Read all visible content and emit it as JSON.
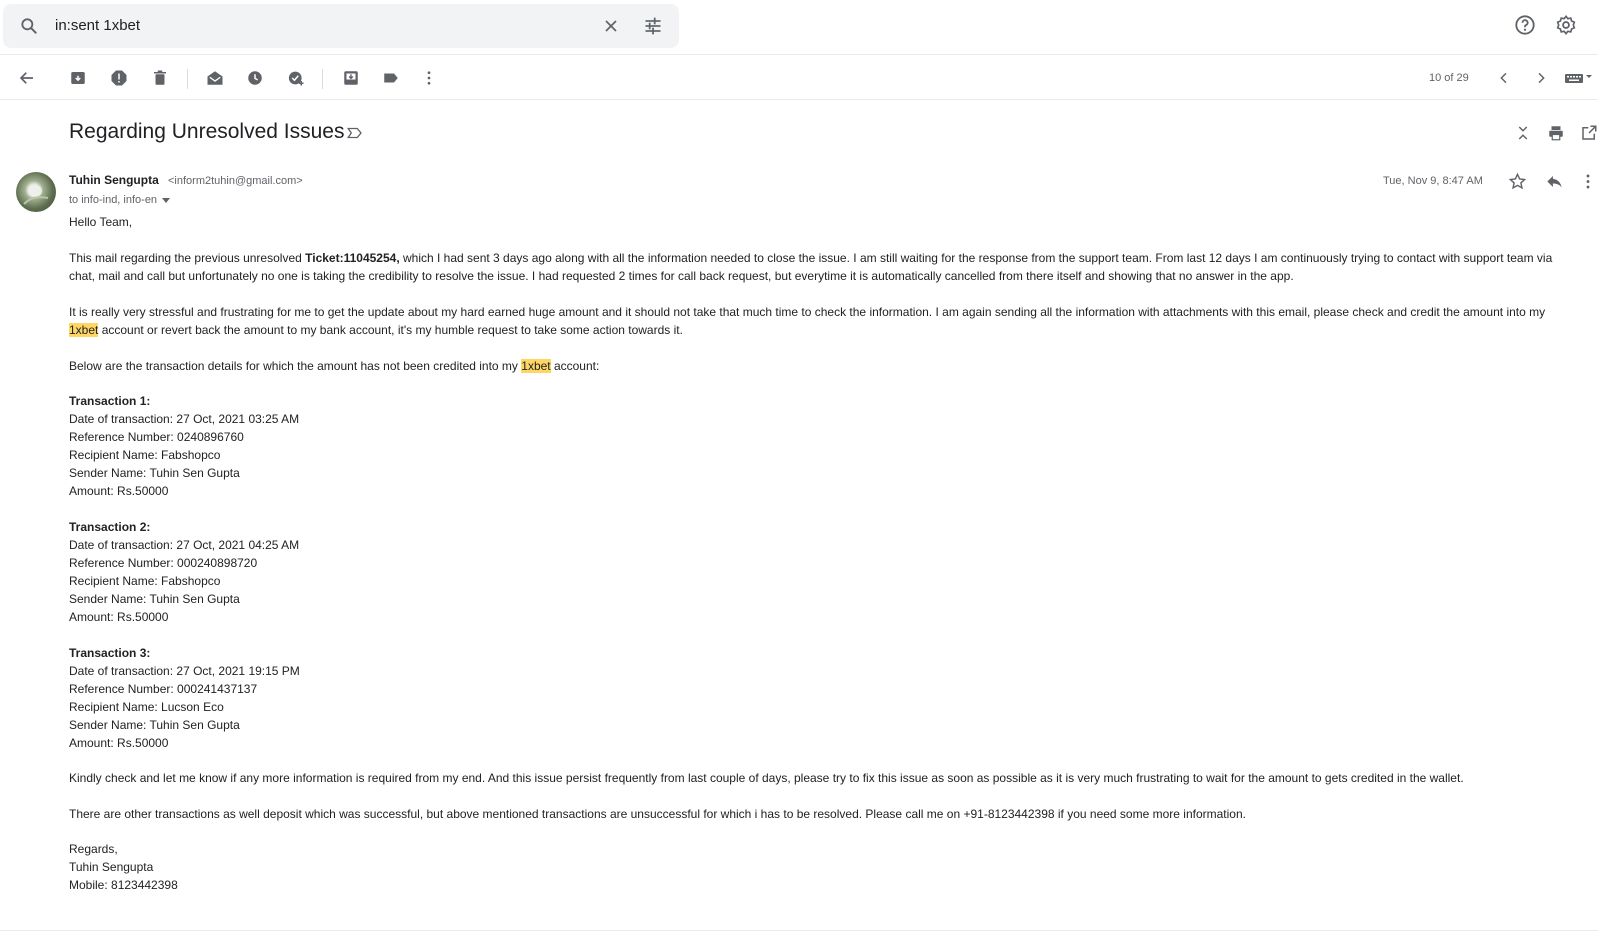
{
  "search": {
    "query": "in:sent 1xbet"
  },
  "toolbar": {
    "icons": [
      "back-arrow-icon",
      "archive-icon",
      "report-spam-icon",
      "delete-icon",
      "mark-unread-icon",
      "snooze-icon",
      "add-task-icon",
      "move-to-icon",
      "label-icon",
      "more-vert-icon"
    ],
    "pager": "10 of 29"
  },
  "email": {
    "subject": "Regarding Unresolved Issues",
    "sender_name": "Tuhin Sengupta",
    "sender_email": "<inform2tuhin@gmail.com>",
    "recipients": "to info-ind, info-en",
    "date": "Tue, Nov 9, 8:47 AM"
  },
  "body": {
    "greeting": "Hello Team,",
    "p1_a": "This mail regarding the previous unresolved ",
    "p1_ticket": "Ticket:11045254,",
    "p1_b": " which I had sent 3 days ago along with all the information needed to close the issue. I am still waiting for the response from the support team. From last 12 days I am continuously trying to contact with support team via",
    "p1_c": "chat, mail and call but unfortunately no one is taking the credibility to resolve the issue. I had requested 2 times for call back request,  but everytime it is automatically cancelled from there itself and showing that no answer in the app.",
    "p2_a": "It is really very stressful and frustrating for me to get the update about my hard earned huge amount and it should not take that much time to check the information. I am again sending all the information with attachments with this email, please check and credit the amount into my",
    "p2_hl": "1xbet",
    "p2_b": " account or revert back the amount to my bank account, it's my humble request to take some action towards it.",
    "p3_a": "Below are the transaction details for which the amount has not been credited into my ",
    "p3_hl": "1xbet",
    "p3_b": " account:",
    "t1_title": "Transaction 1:",
    "t1_date": "Date of transaction: 27 Oct, 2021 03:25 AM",
    "t1_ref": "Reference Number: 0240896760",
    "t1_recipient": "Recipient Name: Fabshopco",
    "t1_sender": "Sender Name: Tuhin Sen Gupta",
    "t1_amount": "Amount: Rs.50000",
    "t2_title": "Transaction 2:",
    "t2_date": "Date of transaction: 27 Oct, 2021 04:25 AM",
    "t2_ref": "Reference Number: 000240898720",
    "t2_recipient": "Recipient Name: Fabshopco",
    "t2_sender": "Sender Name: Tuhin Sen Gupta",
    "t2_amount": "Amount: Rs.50000",
    "t3_title": "Transaction 3:",
    "t3_date": "Date of transaction: 27 Oct, 2021 19:15 PM",
    "t3_ref": "Reference Number: 000241437137",
    "t3_recipient": "Recipient Name: Lucson Eco",
    "t3_sender": "Sender Name: Tuhin Sen Gupta",
    "t3_amount": "Amount: Rs.50000",
    "p4": "Kindly check and let me know if any more information is required from my end. And this issue persist frequently from last couple of days, please try to fix this issue as soon as possible as it is very much frustrating to wait for the amount to gets credited in the wallet.",
    "p5": "There are other transactions as well deposit which was successful, but above mentioned transactions are unsuccessful for which i has to be resolved. Please call me on +91-8123442398 if you need some more information.",
    "regards": "Regards,",
    "sig_name": "Tuhin Sengupta",
    "sig_mobile": "Mobile: 8123442398"
  },
  "colors": {
    "highlight": "#fdd663",
    "search_bg": "#f1f3f4",
    "icon": "#5f6368"
  }
}
